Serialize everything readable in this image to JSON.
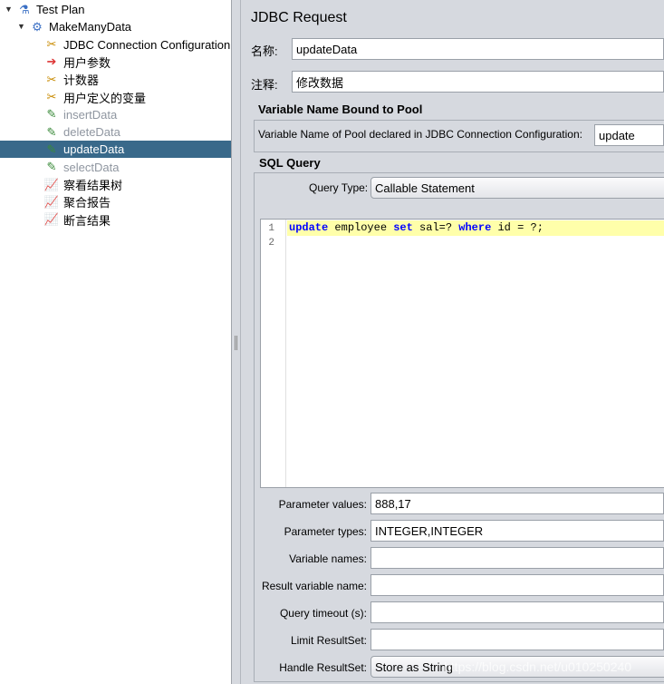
{
  "tree": [
    {
      "label": "Test Plan",
      "icon": "flask-icon",
      "expanded": true
    },
    {
      "label": "MakeManyData",
      "icon": "gear-icon",
      "expanded": true
    },
    {
      "label": "JDBC Connection Configuration",
      "icon": "wrench-icon"
    },
    {
      "label": "用户参数",
      "icon": "preprocessor-icon"
    },
    {
      "label": "计数器",
      "icon": "wrench-icon"
    },
    {
      "label": "用户定义的变量",
      "icon": "wrench-icon"
    },
    {
      "label": "insertData",
      "icon": "dropper-icon",
      "disabled": true
    },
    {
      "label": "deleteData",
      "icon": "dropper-icon",
      "disabled": true
    },
    {
      "label": "updateData",
      "icon": "dropper-icon",
      "selected": true
    },
    {
      "label": "selectData",
      "icon": "dropper-icon",
      "disabled": true
    },
    {
      "label": "察看结果树",
      "icon": "listener-icon"
    },
    {
      "label": "聚合报告",
      "icon": "listener-icon"
    },
    {
      "label": "断言结果",
      "icon": "listener-icon"
    }
  ],
  "panel": {
    "title": "JDBC Request",
    "name_label": "名称:",
    "name_value": "updateData",
    "comment_label": "注释:",
    "comment_value": "修改数据",
    "pool_section": "Variable Name Bound to Pool",
    "pool_label": "Variable Name of Pool declared in JDBC Connection Configuration:",
    "pool_value": "update",
    "sql_section": "SQL Query",
    "query_type_label": "Query Type:",
    "query_type_value": "Callable Statement",
    "code_lines": [
      "1",
      "2"
    ],
    "code": {
      "kw1": "update",
      "t1": " employee ",
      "kw2": "set",
      "t2": " sal=? ",
      "kw3": "where",
      "t3": " id = ?;"
    },
    "params": [
      {
        "label": "Parameter values:",
        "value": "888,17"
      },
      {
        "label": "Parameter types:",
        "value": "INTEGER,INTEGER"
      },
      {
        "label": "Variable names:",
        "value": ""
      },
      {
        "label": "Result variable name:",
        "value": ""
      },
      {
        "label": "Query timeout (s):",
        "value": ""
      },
      {
        "label": "Limit ResultSet:",
        "value": ""
      },
      {
        "label": "Handle ResultSet:",
        "value": "Store as String",
        "combo": true
      }
    ],
    "watermark": "https://blog.csdn.net/u010250240"
  },
  "colors": {
    "selection": "#39698a",
    "keyword": "#0000ff",
    "current_line": "#ffffaa"
  }
}
